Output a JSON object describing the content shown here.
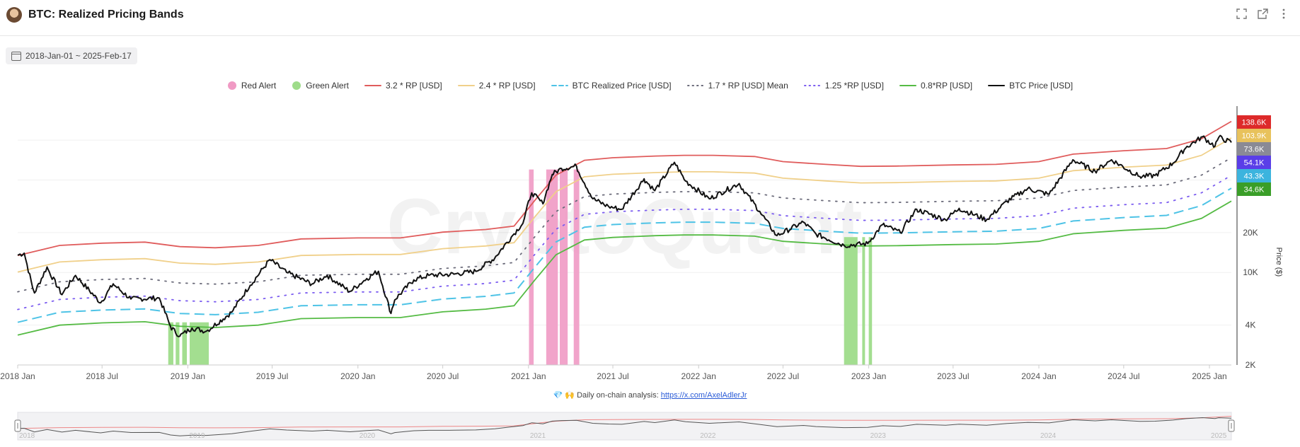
{
  "header": {
    "title": "BTC: Realized Pricing Bands",
    "icons": [
      "fullscreen-icon",
      "external-link-icon",
      "more-vertical-icon"
    ]
  },
  "date_range": "2018-Jan-01 ~ 2025-Feb-17",
  "footnote": {
    "prefix": "💎 🙌 Daily on-chain analysis: ",
    "link_text": "https://x.com/AxelAdlerJr"
  },
  "colors": {
    "red_alert": "#f09ac4",
    "green_alert": "#9edc8a",
    "rp_3_2": "#e05c5c",
    "rp_2_4": "#f0d08a",
    "realized": "#4ec3e6",
    "rp_1_7": "#6b6b7a",
    "rp_1_25": "#7b5cf0",
    "rp_0_8": "#55bb44",
    "price": "#111111"
  },
  "chart_data": {
    "type": "line",
    "y_scale": "log",
    "ylabel": "Price ($)",
    "ylim": [
      2000,
      170000
    ],
    "y_ticks": [
      {
        "value": 2000,
        "label": "2K"
      },
      {
        "value": 4000,
        "label": "4K"
      },
      {
        "value": 10000,
        "label": "10K"
      },
      {
        "value": 20000,
        "label": "20K"
      }
    ],
    "x_ticks": [
      "2018 Jan",
      "2018 Jul",
      "2019 Jan",
      "2019 Jul",
      "2020 Jan",
      "2020 Jul",
      "2021 Jan",
      "2021 Jul",
      "2022 Jan",
      "2022 Jul",
      "2023 Jan",
      "2023 Jul",
      "2024 Jan",
      "2024 Jul",
      "2025 Jan"
    ],
    "x_tick_dates": [
      "2018-01-01",
      "2018-07-01",
      "2019-01-01",
      "2019-07-01",
      "2020-01-01",
      "2020-07-01",
      "2021-01-01",
      "2021-07-01",
      "2022-01-01",
      "2022-07-01",
      "2023-01-01",
      "2023-07-01",
      "2024-01-01",
      "2024-07-01",
      "2025-01-01"
    ],
    "x_range": [
      "2018-01-01",
      "2025-02-17"
    ],
    "legend": [
      {
        "key": "red_alert",
        "label": "Red Alert",
        "style": "dot"
      },
      {
        "key": "green_alert",
        "label": "Green Alert",
        "style": "dot"
      },
      {
        "key": "rp_3_2",
        "label": "3.2 * RP [USD]",
        "style": "solid"
      },
      {
        "key": "rp_2_4",
        "label": "2.4 * RP [USD]",
        "style": "solid"
      },
      {
        "key": "realized",
        "label": "BTC Realized Price [USD]",
        "style": "dashed"
      },
      {
        "key": "rp_1_7",
        "label": "1.7 * RP [USD] Mean",
        "style": "dotted"
      },
      {
        "key": "rp_1_25",
        "label": "1.25 *RP [USD]",
        "style": "dotted"
      },
      {
        "key": "rp_0_8",
        "label": "0.8*RP [USD]",
        "style": "solid"
      },
      {
        "key": "price",
        "label": "BTC Price [USD]",
        "style": "solid"
      }
    ],
    "realized_price": {
      "dates": [
        "2018-01-01",
        "2018-04-01",
        "2018-07-01",
        "2018-10-01",
        "2018-12-15",
        "2019-03-01",
        "2019-06-01",
        "2019-09-01",
        "2020-01-01",
        "2020-04-01",
        "2020-07-01",
        "2020-10-01",
        "2020-12-01",
        "2021-01-15",
        "2021-03-01",
        "2021-05-01",
        "2021-07-01",
        "2021-10-01",
        "2021-12-01",
        "2022-02-01",
        "2022-05-01",
        "2022-07-01",
        "2022-10-01",
        "2022-12-15",
        "2023-03-01",
        "2023-07-01",
        "2023-10-01",
        "2024-01-01",
        "2024-03-15",
        "2024-07-01",
        "2024-10-01",
        "2024-12-15",
        "2025-02-17"
      ],
      "values": [
        4200,
        5000,
        5200,
        5300,
        4900,
        4800,
        5000,
        5600,
        5700,
        5700,
        6300,
        6600,
        7000,
        11000,
        17000,
        22000,
        23000,
        23700,
        24000,
        24000,
        23500,
        21500,
        20500,
        19800,
        19900,
        20300,
        20500,
        21500,
        24500,
        26000,
        27000,
        32000,
        43300
      ]
    },
    "band_multipliers": {
      "rp_3_2": 3.2,
      "rp_2_4": 2.4,
      "rp_1_7": 1.7,
      "rp_1_25": 1.25,
      "realized": 1.0,
      "rp_0_8": 0.8
    },
    "price": {
      "dates": [
        "2018-01-01",
        "2018-01-15",
        "2018-02-06",
        "2018-03-05",
        "2018-04-06",
        "2018-05-05",
        "2018-06-28",
        "2018-07-25",
        "2018-09-01",
        "2018-11-01",
        "2018-11-25",
        "2018-12-15",
        "2019-01-10",
        "2019-02-10",
        "2019-04-05",
        "2019-05-15",
        "2019-06-26",
        "2019-08-01",
        "2019-09-25",
        "2019-10-27",
        "2019-12-15",
        "2020-01-20",
        "2020-02-14",
        "2020-03-12",
        "2020-03-20",
        "2020-04-30",
        "2020-06-01",
        "2020-07-25",
        "2020-09-10",
        "2020-10-21",
        "2020-11-25",
        "2020-12-20",
        "2021-01-08",
        "2021-02-01",
        "2021-02-21",
        "2021-03-13",
        "2021-04-14",
        "2021-05-19",
        "2021-06-22",
        "2021-07-20",
        "2021-09-06",
        "2021-09-29",
        "2021-11-10",
        "2021-12-04",
        "2022-01-24",
        "2022-03-29",
        "2022-05-12",
        "2022-06-18",
        "2022-08-14",
        "2022-09-10",
        "2022-11-09",
        "2022-12-30",
        "2023-01-31",
        "2023-03-10",
        "2023-04-14",
        "2023-06-15",
        "2023-07-14",
        "2023-09-11",
        "2023-10-25",
        "2023-12-08",
        "2024-01-23",
        "2024-03-14",
        "2024-05-01",
        "2024-06-05",
        "2024-08-05",
        "2024-09-06",
        "2024-10-15",
        "2024-11-12",
        "2024-12-17",
        "2025-01-13",
        "2025-01-21",
        "2025-02-17"
      ],
      "values": [
        13500,
        14000,
        7000,
        11000,
        6800,
        9500,
        5900,
        8200,
        6300,
        6400,
        3900,
        3300,
        3800,
        3600,
        5000,
        8000,
        12500,
        10000,
        8200,
        9500,
        7200,
        9000,
        10200,
        4900,
        6200,
        8800,
        9500,
        9700,
        10200,
        12900,
        18500,
        23500,
        40000,
        33000,
        55000,
        61000,
        63500,
        36000,
        31500,
        30000,
        51000,
        41500,
        68000,
        49000,
        36000,
        47000,
        29000,
        19000,
        24000,
        19500,
        16000,
        16500,
        23000,
        20000,
        30000,
        25000,
        30500,
        25000,
        34500,
        43000,
        39000,
        71000,
        58000,
        71000,
        53000,
        54000,
        67000,
        88000,
        106000,
        90000,
        105000,
        96000
      ]
    },
    "red_alert_ranges": [
      [
        "2021-01-02",
        "2021-01-12"
      ],
      [
        "2021-02-08",
        "2021-03-05"
      ],
      [
        "2021-03-09",
        "2021-03-26"
      ],
      [
        "2021-04-08",
        "2021-04-20"
      ]
    ],
    "green_alert_ranges": [
      [
        "2018-11-20",
        "2018-12-01"
      ],
      [
        "2018-12-06",
        "2018-12-14"
      ],
      [
        "2018-12-20",
        "2018-12-30"
      ],
      [
        "2019-01-05",
        "2019-02-15"
      ],
      [
        "2022-11-09",
        "2022-12-08"
      ],
      [
        "2022-12-18",
        "2022-12-24"
      ],
      [
        "2023-01-01",
        "2023-01-08"
      ]
    ],
    "latest_labels": [
      {
        "key": "rp_3_2",
        "label": "138.6K",
        "color": "#dd2a2a"
      },
      {
        "key": "rp_2_4",
        "label": "103.9K",
        "color": "#e8c25c"
      },
      {
        "key": "rp_1_7",
        "label": "73.6K",
        "color": "#8a8a95"
      },
      {
        "key": "rp_1_25",
        "label": "54.1K",
        "color": "#5a3ee8"
      },
      {
        "key": "realized",
        "label": "43.3K",
        "color": "#3cb4de"
      },
      {
        "key": "rp_0_8",
        "label": "34.6K",
        "color": "#3a9e28"
      }
    ],
    "watermark": "CryptoQuant",
    "navigator_labels": [
      "2018",
      "2019",
      "2020",
      "2021",
      "2022",
      "2023",
      "2024",
      "2025"
    ]
  }
}
